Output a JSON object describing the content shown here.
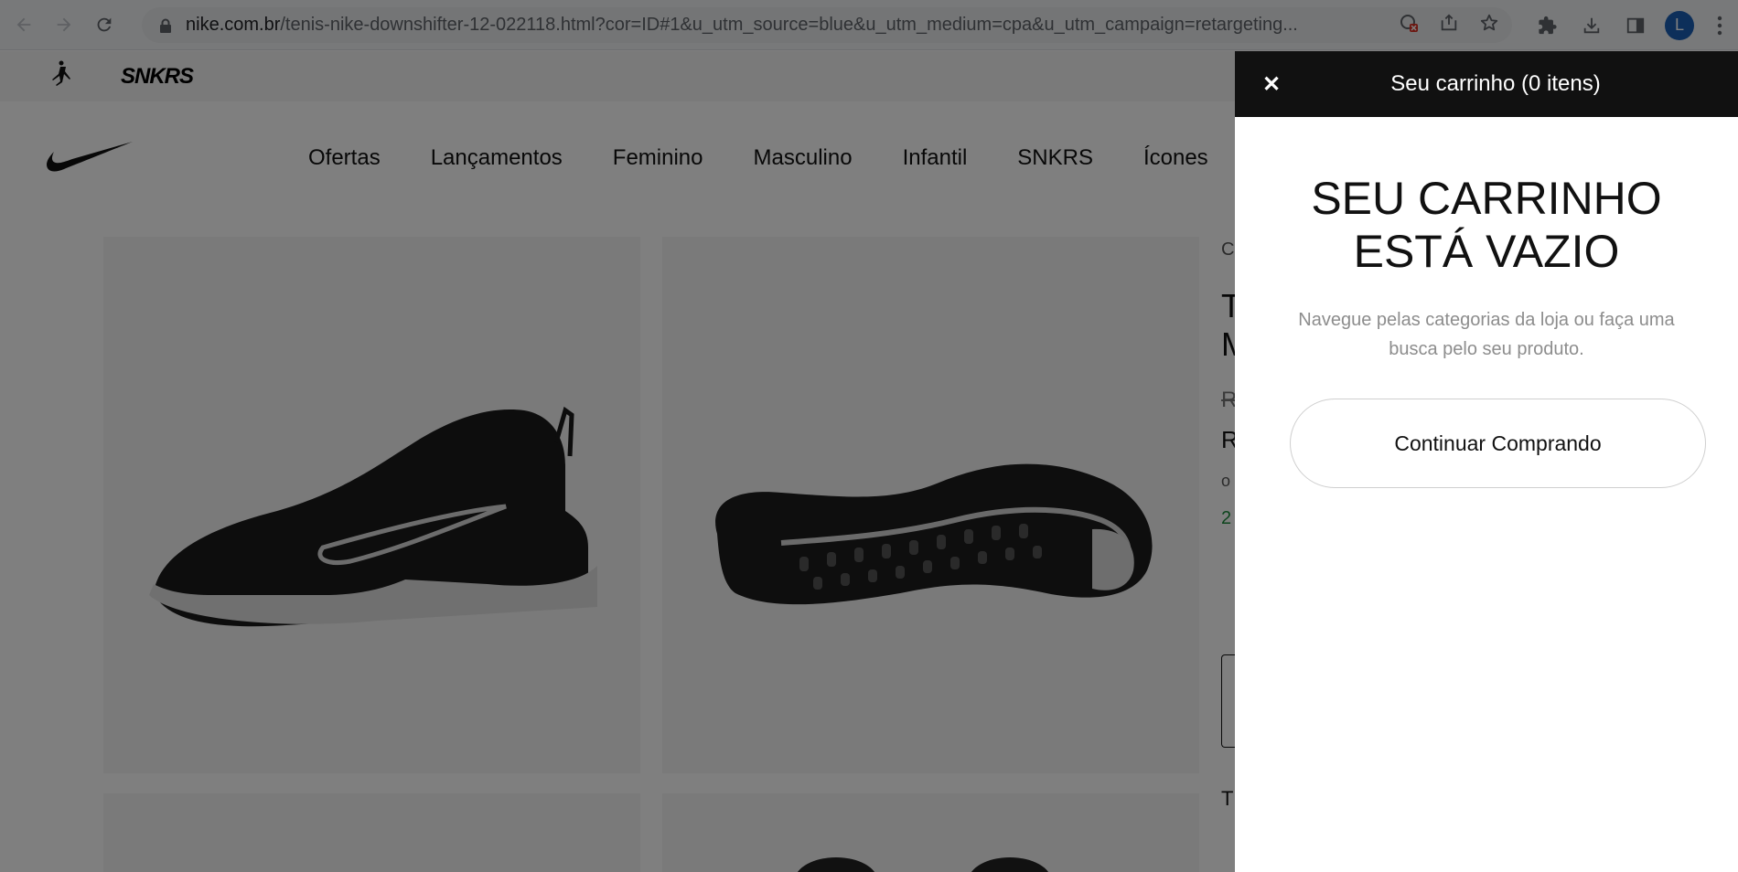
{
  "browser": {
    "url_domain": "nike.com.br",
    "url_rest": "/tenis-nike-downshifter-12-022118.html?cor=ID#1&u_utm_source=blue&u_utm_medium=cpa&u_utm_campaign=retargeting...",
    "profile_initial": "L"
  },
  "site": {
    "topbar_brand": "SNKRS",
    "nav": [
      "Ofertas",
      "Lançamentos",
      "Feminino",
      "Masculino",
      "Infantil",
      "SNKRS",
      "Ícones"
    ]
  },
  "product_partial": {
    "breadcrumb": "C",
    "title_line1": "T",
    "title_line2": "M",
    "old_price": "R",
    "price": "R",
    "installments": "o",
    "green_text": "2",
    "size_label": "T"
  },
  "cart": {
    "title": "Seu carrinho (0 itens)",
    "empty_title_line1": "SEU CARRINHO",
    "empty_title_line2": "ESTÁ VAZIO",
    "empty_desc": "Navegue pelas categorias da loja ou faça uma busca pelo seu produto.",
    "continue_label": "Continuar Comprando"
  }
}
